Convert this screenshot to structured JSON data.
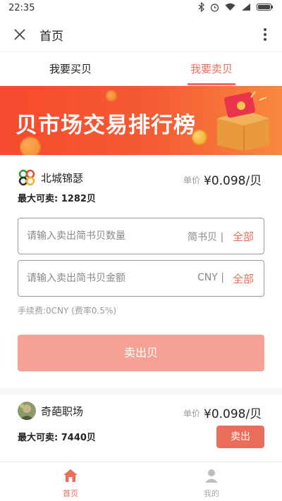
{
  "status_bar": {
    "time": "22:35"
  },
  "nav": {
    "title": "首页"
  },
  "tabs": [
    {
      "label": "我要买贝"
    },
    {
      "label": "我要卖贝"
    }
  ],
  "banner": {
    "title": "贝市场交易排行榜"
  },
  "listings": [
    {
      "name": "北城锦瑟",
      "price_label": "单价",
      "price": "¥0.098/贝",
      "max_sell": "最大可卖: 1282贝",
      "amount_input": {
        "placeholder": "请输入卖出简书贝数量",
        "unit": "简书贝 |",
        "all_label": "全部"
      },
      "cny_input": {
        "placeholder": "请输入卖出简书贝金额",
        "unit": "CNY |",
        "all_label": "全部"
      },
      "fee": "手续费:0CNY (费率0.5%)",
      "sell_label": "卖出贝"
    },
    {
      "name": "奇葩职场",
      "price_label": "单价",
      "price": "¥0.098/贝",
      "max_sell": "最大可卖: 7440贝",
      "sell_label": "卖出"
    }
  ],
  "bottom_nav": [
    {
      "label": "首页",
      "icon": "home-icon"
    },
    {
      "label": "我的",
      "icon": "user-icon"
    }
  ],
  "colors": {
    "accent": "#ea6f5a",
    "accent_light": "#f5a194",
    "banner": "#f64a2e"
  }
}
